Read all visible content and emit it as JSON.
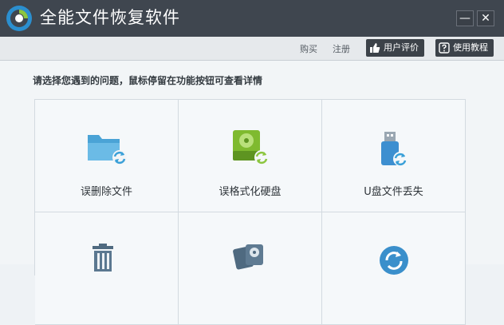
{
  "window": {
    "title": "全能文件恢复软件",
    "minimize_glyph": "—",
    "close_glyph": "✕"
  },
  "toolbar": {
    "buy": "购买",
    "register": "注册",
    "review": "用户评价",
    "tutorial": "使用教程"
  },
  "main": {
    "prompt": "请选择您遇到的问题，鼠标停留在功能按钮可查看详情",
    "options": [
      {
        "label": "误删除文件",
        "icon": "folder-recover-icon"
      },
      {
        "label": "误格式化硬盘",
        "icon": "harddisk-recover-icon"
      },
      {
        "label": "U盘文件丢失",
        "icon": "usb-recover-icon"
      },
      {
        "label": "",
        "icon": "recycle-bin-icon"
      },
      {
        "label": "",
        "icon": "disk-partition-icon"
      },
      {
        "label": "",
        "icon": "refresh-icon"
      }
    ]
  },
  "colors": {
    "titlebar": "#3f464f",
    "accent_blue": "#3aa0d8",
    "accent_green": "#8cc63f"
  }
}
